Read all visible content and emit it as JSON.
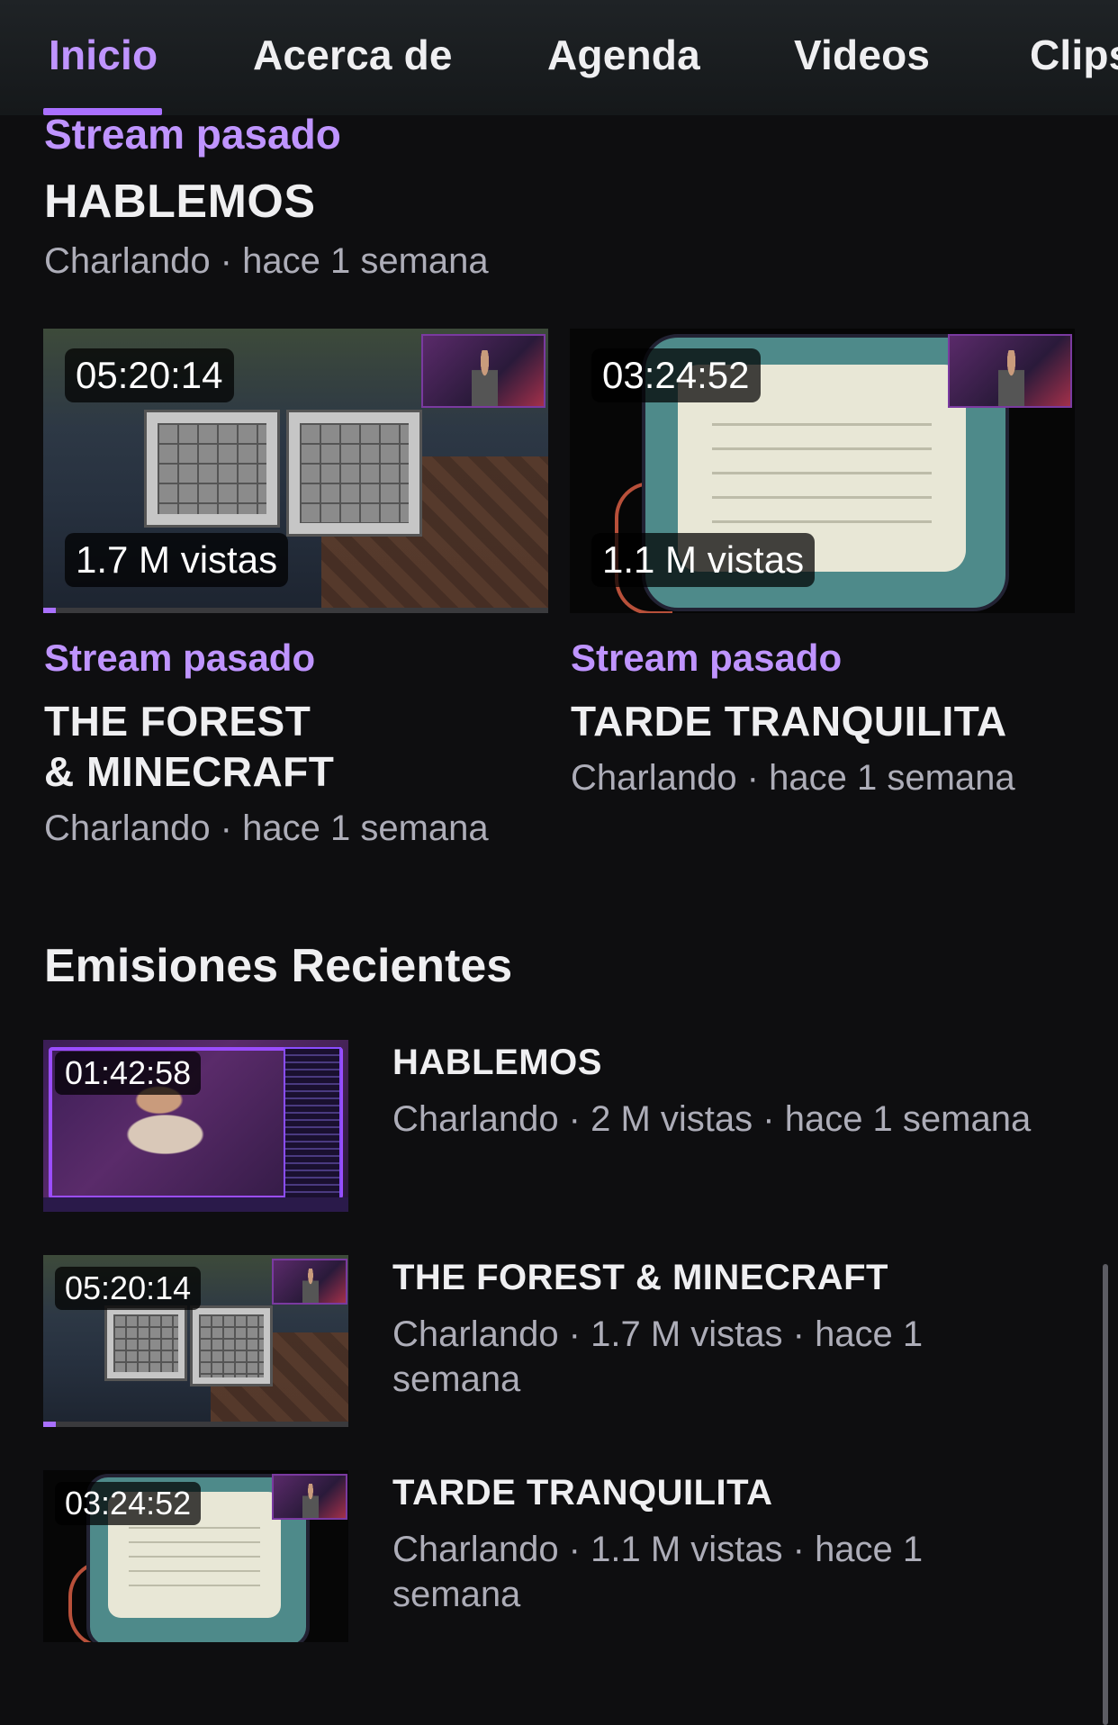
{
  "tabs": [
    {
      "label": "Inicio",
      "active": true
    },
    {
      "label": "Acerca de"
    },
    {
      "label": "Agenda"
    },
    {
      "label": "Videos"
    },
    {
      "label": "Clips"
    }
  ],
  "colors": {
    "accent": "#a970ff",
    "accent_text": "#bf94ff",
    "background": "#0e0e10",
    "meta_text": "#adadb8"
  },
  "featured_top": {
    "tag": "Stream pasado",
    "title": "HABLEMOS",
    "meta": "Charlando · hace 1 semana"
  },
  "cards": [
    {
      "duration": "05:20:14",
      "views": "1.7 M vistas",
      "tag": "Stream pasado",
      "title_line1": "THE FOREST",
      "title_line2": "& MINECRAFT",
      "meta": "Charlando · hace 1 semana",
      "progress": 0.03
    },
    {
      "duration": "03:24:52",
      "views": "1.1 M vistas",
      "tag": "Stream pasado",
      "title_line1": "TARDE TRANQUILITA",
      "title_line2": "",
      "meta": "Charlando · hace 1 semana",
      "progress": 0
    }
  ],
  "recent": {
    "title": "Emisiones Recientes",
    "items": [
      {
        "duration": "01:42:58",
        "title": "HABLEMOS",
        "meta": "Charlando · 2 M vistas · hace 1 semana",
        "progress": 0
      },
      {
        "duration": "05:20:14",
        "title": "THE FOREST & MINECRAFT",
        "meta": "Charlando · 1.7 M vistas · hace 1 semana",
        "progress": 0.04
      },
      {
        "duration": "03:24:52",
        "title": "TARDE TRANQUILITA",
        "meta": "Charlando · 1.1 M vistas · hace 1 semana",
        "progress": 0
      }
    ]
  }
}
